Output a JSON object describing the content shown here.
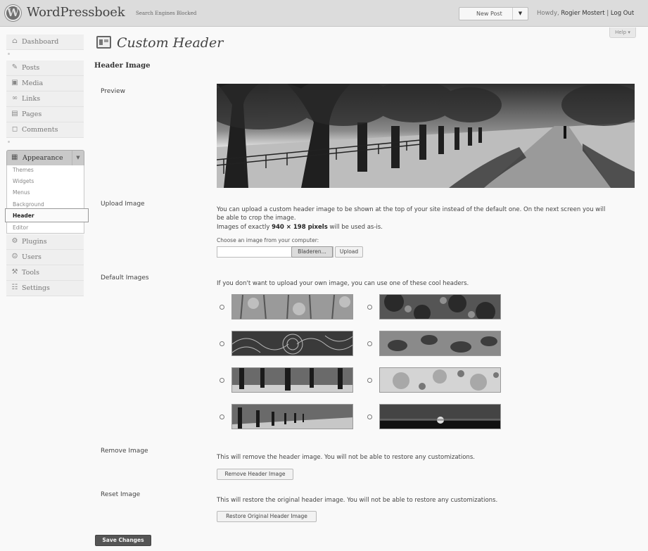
{
  "topbar": {
    "logo_letter": "W",
    "site_title": "WordPressboek",
    "site_subtitle": "Search Engines Blocked",
    "new_post": "New Post",
    "howdy": "Howdy,",
    "user": "Rogier Mostert",
    "separator": "|",
    "logout": "Log Out",
    "help": "Help"
  },
  "sidebar": {
    "dashboard": "Dashboard",
    "posts": "Posts",
    "media": "Media",
    "links": "Links",
    "pages": "Pages",
    "comments": "Comments",
    "appearance": "Appearance",
    "submenu": [
      "Themes",
      "Widgets",
      "Menus",
      "Background",
      "Header",
      "Editor"
    ],
    "plugins": "Plugins",
    "users": "Users",
    "tools": "Tools",
    "settings": "Settings"
  },
  "page": {
    "title": "Custom Header",
    "section": "Header Image",
    "preview_label": "Preview",
    "upload_label": "Upload Image",
    "upload_text_1": "You can upload a custom header image to be shown at the top of your site instead of the default one. On the next screen you will",
    "upload_text_2": "be able to crop the image.",
    "upload_text_3a": "Images of exactly",
    "upload_text_3b": "940 × 198 pixels",
    "upload_text_3c": "will be used as-is.",
    "choose_label": "Choose an image from your computer:",
    "browse_button": "Bladeren...",
    "upload_button": "Upload",
    "default_label": "Default Images",
    "default_text": "If you don't want to upload your own image, you can use one of these cool headers.",
    "remove_label": "Remove Image",
    "remove_text": "This will remove the header image. You will not be able to restore any customizations.",
    "remove_button": "Remove Header Image",
    "reset_label": "Reset Image",
    "reset_text": "This will restore the original header image. You will not be able to restore any customizations.",
    "restore_button": "Restore Original Header Image",
    "save_button": "Save Changes"
  }
}
